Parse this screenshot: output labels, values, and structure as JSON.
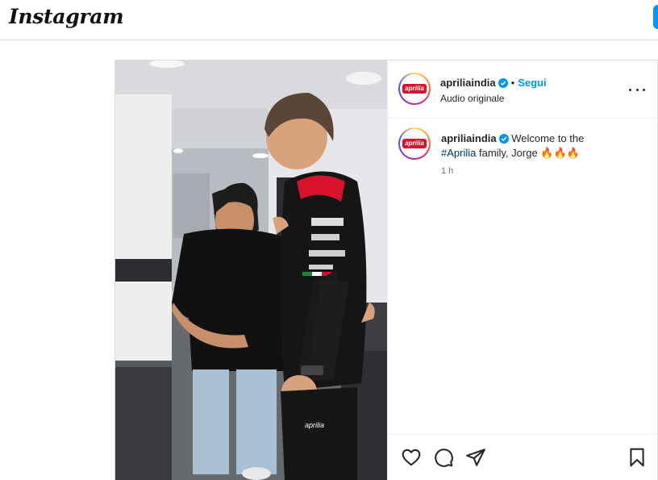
{
  "app": {
    "logo_text": "Instagram"
  },
  "post": {
    "author": {
      "username": "apriliaindia",
      "avatar_label": "aprilia",
      "verified": true,
      "follow_label": "Segui",
      "separator": "•",
      "audio_label": "Audio originale"
    },
    "caption": {
      "username": "apriliaindia",
      "text_before": "Welcome to the ",
      "hashtag": "#Aprilia",
      "text_after": " family, Jorge ",
      "emojis": "🔥🔥🔥",
      "time": "1 h"
    },
    "actions": [
      "heart-icon",
      "comment-icon",
      "share-icon",
      "save-icon"
    ]
  },
  "colors": {
    "accent": "#0095f6",
    "verified": "#0095f6",
    "brand_red": "#d7132c",
    "hashtag": "#00376b"
  }
}
